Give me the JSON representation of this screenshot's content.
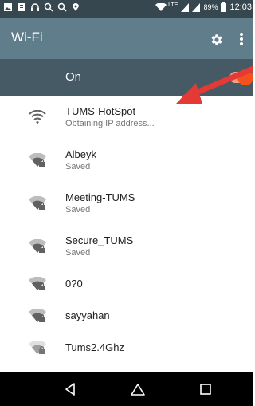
{
  "status_bar": {
    "battery_text": "89%",
    "time": "12:03",
    "network_tag": "LTE"
  },
  "app_bar": {
    "title": "Wi-Fi"
  },
  "master_switch": {
    "label": "On",
    "enabled": true
  },
  "networks": [
    {
      "name": "TUMS-HotSpot",
      "status": "Obtaining IP address...",
      "secured": false
    },
    {
      "name": "Albeyk",
      "status": "Saved",
      "secured": true
    },
    {
      "name": "Meeting-TUMS",
      "status": "Saved",
      "secured": true
    },
    {
      "name": "Secure_TUMS",
      "status": "Saved",
      "secured": true
    },
    {
      "name": "0?0",
      "status": "",
      "secured": true
    },
    {
      "name": "sayyahan",
      "status": "",
      "secured": true
    },
    {
      "name": "Tums2.4Ghz",
      "status": "",
      "secured": true
    }
  ],
  "colors": {
    "status_bar": "#36474f",
    "app_bar": "#607d8b",
    "master_bar": "#455a64",
    "toggle_on": "#f4511e",
    "arrow": "#e53935"
  },
  "icons": {
    "status_left": [
      "image-icon",
      "document-icon",
      "headphones-icon",
      "search-notify-icon",
      "search-notify-icon",
      "location-icon"
    ],
    "settings": "gear-icon",
    "overflow": "more-vert-icon",
    "nav": [
      "back-icon",
      "home-icon",
      "recents-icon"
    ]
  }
}
